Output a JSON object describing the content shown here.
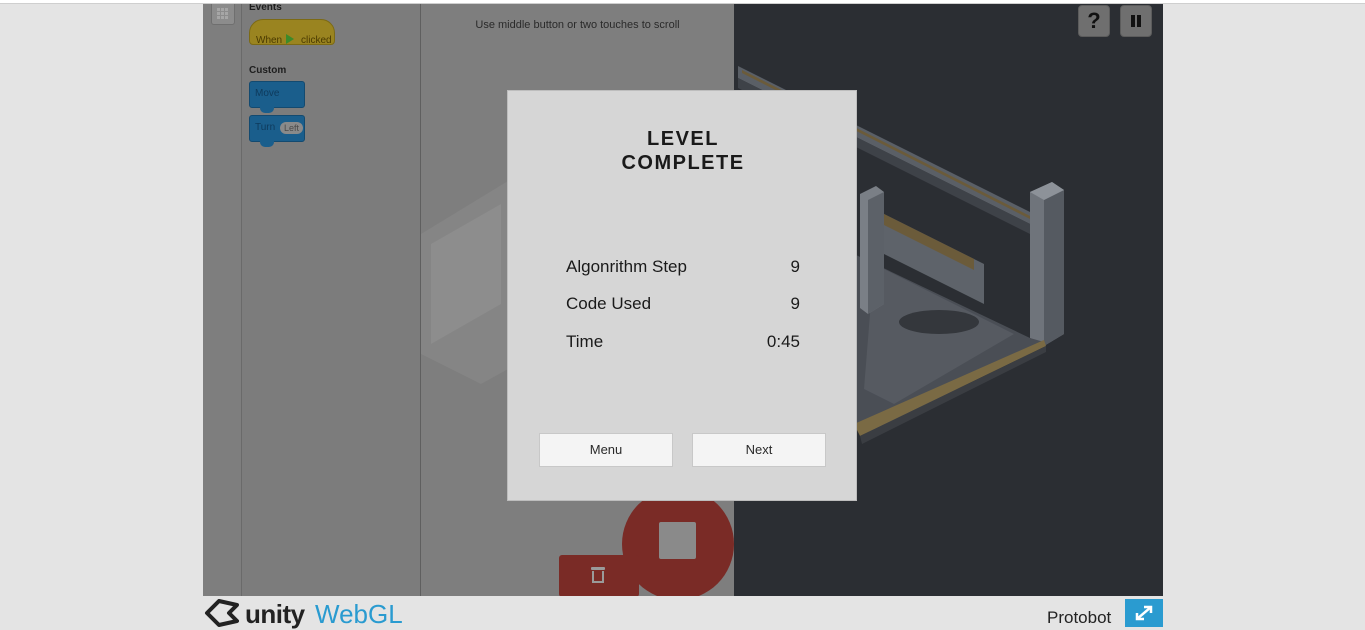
{
  "palette": {
    "categories": {
      "events": "Events",
      "custom": "Custom"
    },
    "blocks": {
      "when_clicked": {
        "prefix": "When",
        "suffix": "clicked"
      },
      "move": "Move",
      "turn": {
        "label": "Turn",
        "dropdown": "Left"
      }
    }
  },
  "workspace": {
    "hint": "Use middle button or two touches to scroll"
  },
  "toolbar": {
    "help_label": "?"
  },
  "modal": {
    "title_line1": "LEVEL",
    "title_line2": "COMPLETE",
    "stats": [
      {
        "label": "Algonrithm Step",
        "value": "9"
      },
      {
        "label": "Code Used",
        "value": "9"
      },
      {
        "label": "Time",
        "value": "0:45"
      }
    ],
    "menu_label": "Menu",
    "next_label": "Next"
  },
  "footer": {
    "brand": "unity",
    "product": "WebGL",
    "game_name": "Protobot"
  },
  "colors": {
    "webgl_blue": "#2a9bd0",
    "stop_red": "#7a2b26",
    "modal_bg": "#d6d6d6"
  },
  "icons": [
    "grid-icon",
    "flag-icon",
    "trash-icon",
    "stop-icon",
    "help-icon",
    "pause-icon",
    "unity-logo-icon",
    "fullscreen-icon"
  ]
}
